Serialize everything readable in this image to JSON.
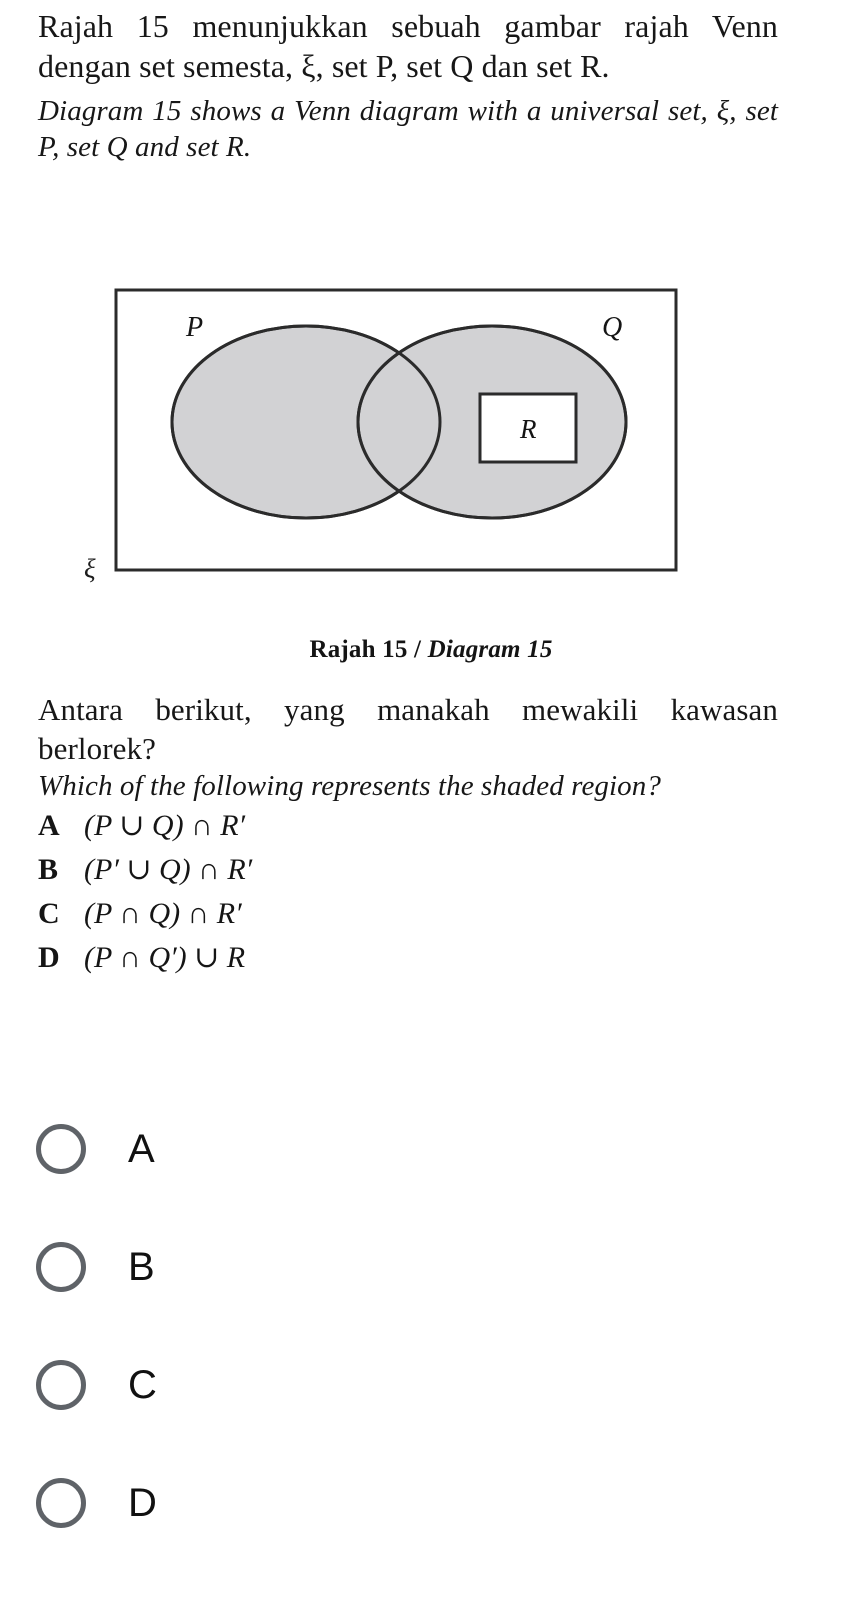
{
  "stem": {
    "malay_prefix": "Rajah 15 menunjukkan sebuah gambar rajah Venn dengan set semesta, ",
    "malay_xi": "ξ",
    "malay_mid": ", set ",
    "malay_p": "P",
    "malay_mid2": ", set ",
    "malay_q": "Q",
    "malay_tail": " dan set ",
    "malay_r": "R",
    "malay_end": ".",
    "malay_full": "Rajah 15 menunjukkan sebuah gambar rajah Venn dengan set semesta, ξ, set P, set Q dan set R.",
    "english_full": "Diagram 15 shows a Venn diagram with a universal set, ξ, set P, set Q and set R."
  },
  "diagram": {
    "universal_label": "ξ",
    "set_p_label": "P",
    "set_q_label": "Q",
    "set_r_label": "R",
    "shade_color": "#d2d2d4",
    "stroke_color": "#2b2b2b",
    "background_color": "#ffffff",
    "caption_malay": "Rajah 15",
    "caption_separator": " / ",
    "caption_english": "Diagram 15"
  },
  "question": {
    "malay": "Antara berikut, yang manakah mewakili kawasan berlorek?",
    "english": "Which of the following represents the shaded region?",
    "options": [
      {
        "letter": "A",
        "expression": "(P ∪ Q) ∩ R′"
      },
      {
        "letter": "B",
        "expression": "(P′ ∪ Q) ∩ R′"
      },
      {
        "letter": "C",
        "expression": "(P ∩ Q) ∩ R′"
      },
      {
        "letter": "D",
        "expression": "(P ∩ Q′) ∪ R"
      }
    ]
  },
  "answer_choices": {
    "radio_border_color": "#5f6368",
    "items": [
      {
        "label": "A",
        "selected": false
      },
      {
        "label": "B",
        "selected": false
      },
      {
        "label": "C",
        "selected": false
      },
      {
        "label": "D",
        "selected": false
      }
    ]
  }
}
